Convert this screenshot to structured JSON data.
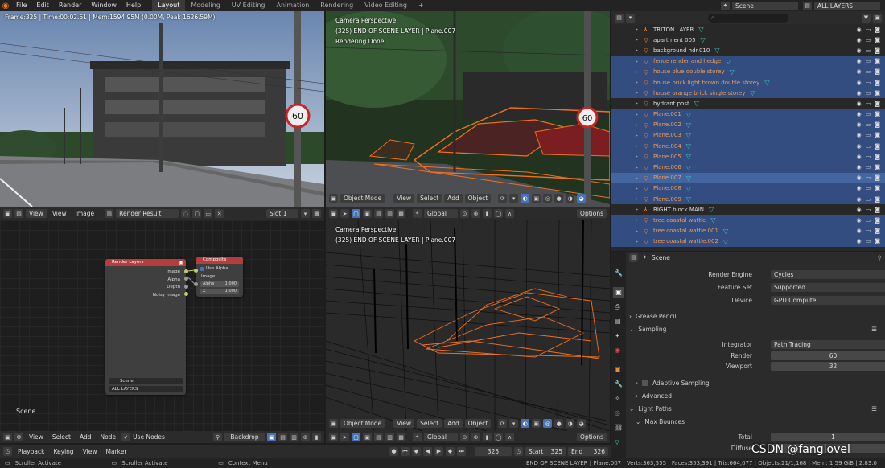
{
  "menu": [
    "File",
    "Edit",
    "Render",
    "Window",
    "Help"
  ],
  "workspaces": [
    {
      "label": "Layout",
      "active": true
    },
    {
      "label": "Modeling",
      "active": false
    },
    {
      "label": "UV Editing",
      "active": false
    },
    {
      "label": "Animation",
      "active": false
    },
    {
      "label": "Rendering",
      "active": false
    },
    {
      "label": "Video Editing",
      "active": false
    }
  ],
  "workspace_add": "+",
  "scene_selector": {
    "value": "Scene"
  },
  "layer_selector": {
    "value": "ALL LAYERS"
  },
  "render_view": {
    "frame_info": "Frame:325 | Time:00:02.61 | Mem:1594.95M (0.00M, Peak 1626.59M)",
    "menus": [
      "View",
      "View",
      "Image"
    ],
    "image_name": "Render Result",
    "slot": "Slot 1"
  },
  "viewport_top": {
    "title": "Camera Perspective",
    "subtitle": "(325) END OF SCENE LAYER | Plane.007",
    "status": "Rendering Done",
    "mode": "Object Mode",
    "menus": [
      "View",
      "Select",
      "Add",
      "Object"
    ]
  },
  "viewport_bottom": {
    "title": "Camera Perspective",
    "subtitle": "(325) END OF SCENE LAYER | Plane.007",
    "mode": "Object Mode",
    "menus": [
      "View",
      "Select",
      "Add",
      "Object"
    ],
    "transform": "Global",
    "options": "Options"
  },
  "viewport_mid_header": {
    "transform": "Global",
    "options": "Options"
  },
  "node_editor": {
    "render_layers_title": "Render Layers",
    "outputs": [
      "Image",
      "Alpha",
      "Depth",
      "Noisy Image"
    ],
    "scene_field": "Scene",
    "layer_field": "ALL LAYERS",
    "composite_title": "Composite",
    "use_alpha": "Use Alpha",
    "inputs": [
      "Image",
      "Alpha",
      "Z"
    ],
    "alpha_value": "1.000",
    "z_value": "1.000",
    "scene_label": "Scene",
    "menus": [
      "View",
      "Select",
      "Add",
      "Node"
    ],
    "use_nodes": "Use Nodes",
    "backdrop": "Backdrop"
  },
  "outliner": {
    "rows": [
      {
        "name": "TRITON LAYER",
        "icon": "rig",
        "selected": false,
        "active": false
      },
      {
        "name": "apartment 005",
        "icon": "tri",
        "selected": false,
        "active": false
      },
      {
        "name": "background hdr.010",
        "icon": "tri",
        "selected": false,
        "active": false
      },
      {
        "name": "fence render and hedge",
        "icon": "tri",
        "selected": true,
        "active": false
      },
      {
        "name": "house blue double storey",
        "icon": "tri",
        "selected": true,
        "active": false
      },
      {
        "name": "house brick light brown double storey",
        "icon": "tri",
        "selected": true,
        "active": false
      },
      {
        "name": "house orange brick single storey",
        "icon": "tri",
        "selected": true,
        "active": false
      },
      {
        "name": "hydrant post",
        "icon": "tri",
        "selected": false,
        "active": false
      },
      {
        "name": "Plane.001",
        "icon": "tri",
        "selected": true,
        "active": false
      },
      {
        "name": "Plane.002",
        "icon": "tri",
        "selected": true,
        "active": false
      },
      {
        "name": "Plane.003",
        "icon": "tri",
        "selected": true,
        "active": false
      },
      {
        "name": "Plane.004",
        "icon": "tri",
        "selected": true,
        "active": false
      },
      {
        "name": "Plane.005",
        "icon": "tri",
        "selected": true,
        "active": false
      },
      {
        "name": "Plane.006",
        "icon": "tri",
        "selected": true,
        "active": false
      },
      {
        "name": "Plane.007",
        "icon": "tri",
        "selected": true,
        "active": true
      },
      {
        "name": "Plane.008",
        "icon": "tri",
        "selected": true,
        "active": false
      },
      {
        "name": "Plane.009",
        "icon": "tri",
        "selected": true,
        "active": false
      },
      {
        "name": "RIGHT block MAIN",
        "icon": "rig",
        "selected": false,
        "active": false
      },
      {
        "name": "tree coastal wattle",
        "icon": "tri",
        "selected": true,
        "active": false
      },
      {
        "name": "tree coastal wattle.001",
        "icon": "tri",
        "selected": true,
        "active": false
      },
      {
        "name": "tree coastal wattle.002",
        "icon": "tri",
        "selected": true,
        "active": false
      }
    ]
  },
  "properties": {
    "scene_name": "Scene",
    "render_engine_label": "Render Engine",
    "render_engine": "Cycles",
    "feature_set_label": "Feature Set",
    "feature_set": "Supported",
    "device_label": "Device",
    "device": "GPU Compute",
    "grease_pencil": "Grease Pencil",
    "sampling": "Sampling",
    "integrator_label": "Integrator",
    "integrator": "Path Tracing",
    "render_label": "Render",
    "render_samples": "60",
    "viewport_label": "Viewport",
    "viewport_samples": "32",
    "adaptive": "Adaptive Sampling",
    "advanced": "Advanced",
    "light_paths": "Light Paths",
    "max_bounces": "Max Bounces",
    "total_label": "Total",
    "total": "1",
    "diffuse_label": "Diffuse"
  },
  "timeline": {
    "menus": [
      "Playback",
      "Keying",
      "View",
      "Marker"
    ],
    "current": "325",
    "start_label": "Start",
    "start": "325",
    "end_label": "End",
    "end": "326"
  },
  "statusbar": {
    "items": [
      "Scroller Activate",
      "Scroller Activate",
      "Context Menu"
    ],
    "info": "END OF SCENE LAYER | Plane.007 | Verts:363,555 | Faces:353,391 | Tris:664,077 | Objects:21/1,168 | Mem: 1.59 GiB | 2.83.0"
  },
  "watermark": "CSDN @fanglovel",
  "colors": {
    "accent": "#4772b3",
    "selection": "#334d80",
    "orange": "#f0883a",
    "header": "#2b2b2b"
  }
}
